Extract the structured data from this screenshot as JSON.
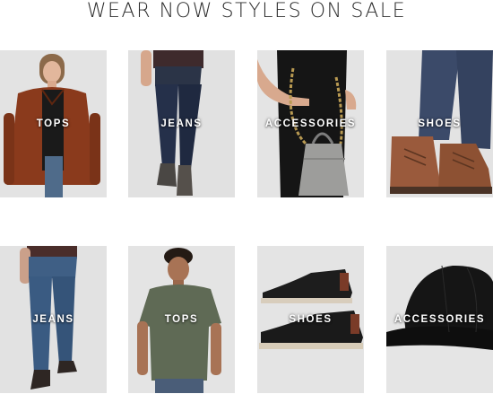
{
  "page": {
    "title": "WEAR NOW STYLES ON SALE"
  },
  "tiles": [
    {
      "label": "TOPS",
      "image": "model-rust-jacket"
    },
    {
      "label": "JEANS",
      "image": "model-dark-skinny-jeans"
    },
    {
      "label": "ACCESSORIES",
      "image": "grey-handbag-chain-strap"
    },
    {
      "label": "SHOES",
      "image": "brown-lace-up-boots"
    },
    {
      "label": "JEANS",
      "image": "model-straight-jeans"
    },
    {
      "label": "TOPS",
      "image": "model-olive-tee"
    },
    {
      "label": "SHOES",
      "image": "black-chukka-shoes"
    },
    {
      "label": "ACCESSORIES",
      "image": "black-trucker-cap"
    }
  ],
  "colors": {
    "title_text": "#2b2b2b",
    "tile_background": "#e7e7e7",
    "label_text": "#ffffff"
  }
}
